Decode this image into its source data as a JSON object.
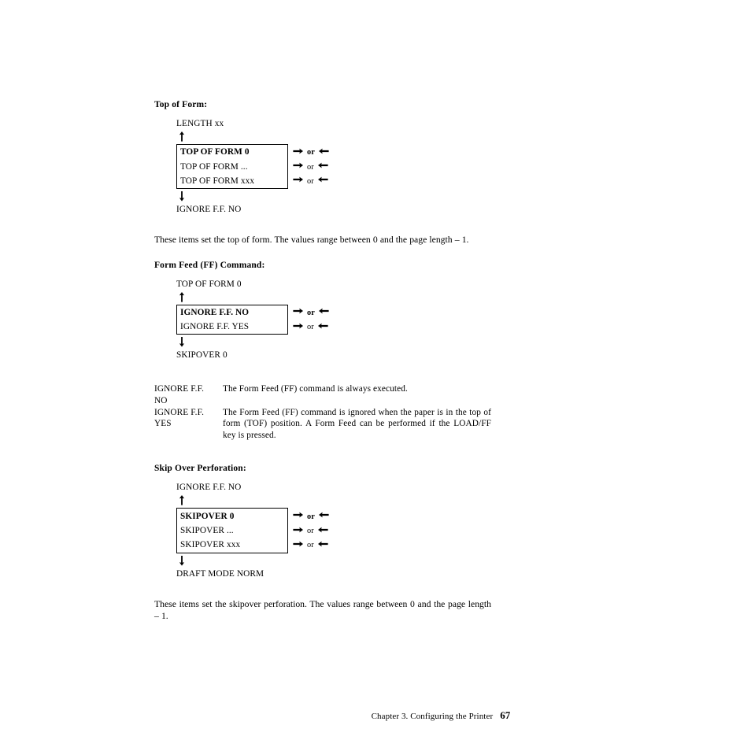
{
  "page": {
    "footer_chapter": "Chapter 3. Configuring the Printer",
    "footer_page_number": "67"
  },
  "icons": {
    "arrow_up": "arrow-up-icon",
    "arrow_down": "arrow-down-icon",
    "arrow_right": "arrow-right-icon",
    "arrow_left": "arrow-left-icon"
  },
  "sections": [
    {
      "heading": "Top of Form:",
      "diagram": {
        "entry_label": "LENGTH xx",
        "exit_label": "IGNORE F.F. NO",
        "rows": [
          {
            "label": "TOP OF FORM 0",
            "bold": true,
            "annotation": "or"
          },
          {
            "label": "TOP OF FORM ...",
            "bold": false,
            "annotation": "or"
          },
          {
            "label": "TOP OF FORM xxx",
            "bold": false,
            "annotation": "or"
          }
        ]
      },
      "paragraph": "These items set the top of form. The values range between 0 and the page length – 1."
    },
    {
      "heading": "Form Feed (FF) Command:",
      "diagram": {
        "entry_label": "TOP OF FORM 0",
        "exit_label": "SKIPOVER 0",
        "rows": [
          {
            "label": "IGNORE F.F. NO",
            "bold": true,
            "annotation": "or"
          },
          {
            "label": "IGNORE F.F. YES",
            "bold": false,
            "annotation": "or"
          }
        ]
      },
      "descriptions": [
        {
          "term": "IGNORE F.F. NO",
          "definition": "The Form Feed (FF) command is always executed."
        },
        {
          "term": "IGNORE F.F. YES",
          "definition": "The Form Feed (FF) command is ignored when the paper is in the top of form (TOF) position. A Form Feed can be performed if the LOAD/FF key is pressed."
        }
      ]
    },
    {
      "heading": "Skip Over Perforation:",
      "diagram": {
        "entry_label": "IGNORE F.F. NO",
        "exit_label": "DRAFT MODE NORM",
        "rows": [
          {
            "label": "SKIPOVER 0",
            "bold": true,
            "annotation": "or"
          },
          {
            "label": "SKIPOVER ...",
            "bold": false,
            "annotation": "or"
          },
          {
            "label": "SKIPOVER xxx",
            "bold": false,
            "annotation": "or"
          }
        ]
      },
      "paragraph": "These items set the skipover perforation. The values range between 0 and the page length – 1."
    }
  ]
}
